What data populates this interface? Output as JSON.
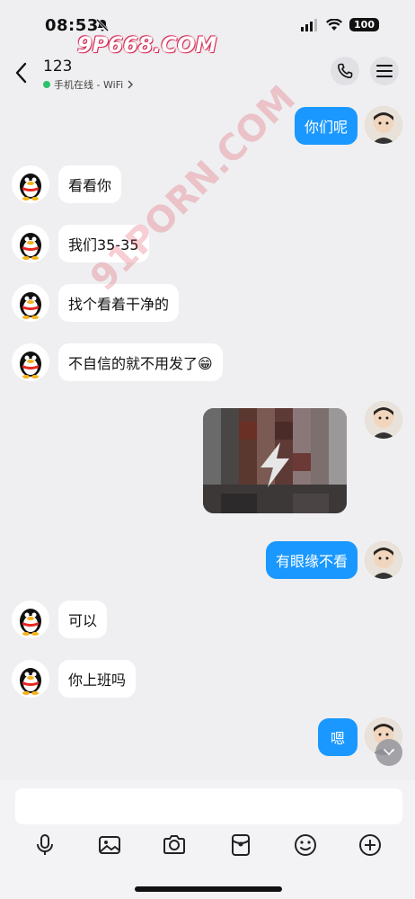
{
  "status": {
    "time": "08:53",
    "battery": "100"
  },
  "watermarks": {
    "top": "9P668.COM",
    "diagonal": "91PORN.COM"
  },
  "header": {
    "title": "123",
    "subtitle": "手机在线 - WiFi"
  },
  "messages": [
    {
      "side": "out",
      "text": "你们呢"
    },
    {
      "side": "in",
      "text": "看看你"
    },
    {
      "side": "in",
      "text": "我们35-35"
    },
    {
      "side": "in",
      "text": "找个看着干净的"
    },
    {
      "side": "in",
      "text": "不自信的就不用发了😁"
    },
    {
      "side": "out",
      "type": "video"
    },
    {
      "side": "out",
      "text": "有眼缘不看"
    },
    {
      "side": "in",
      "text": "可以"
    },
    {
      "side": "in",
      "text": "你上班吗"
    },
    {
      "side": "out",
      "text": "嗯"
    }
  ],
  "colors": {
    "accent": "#1a98ff",
    "online": "#2dc26b",
    "background": "#efeff1"
  },
  "toolbar": {
    "icons": [
      "microphone-icon",
      "image-icon",
      "camera-icon",
      "red-packet-icon",
      "emoji-icon",
      "plus-icon"
    ]
  }
}
